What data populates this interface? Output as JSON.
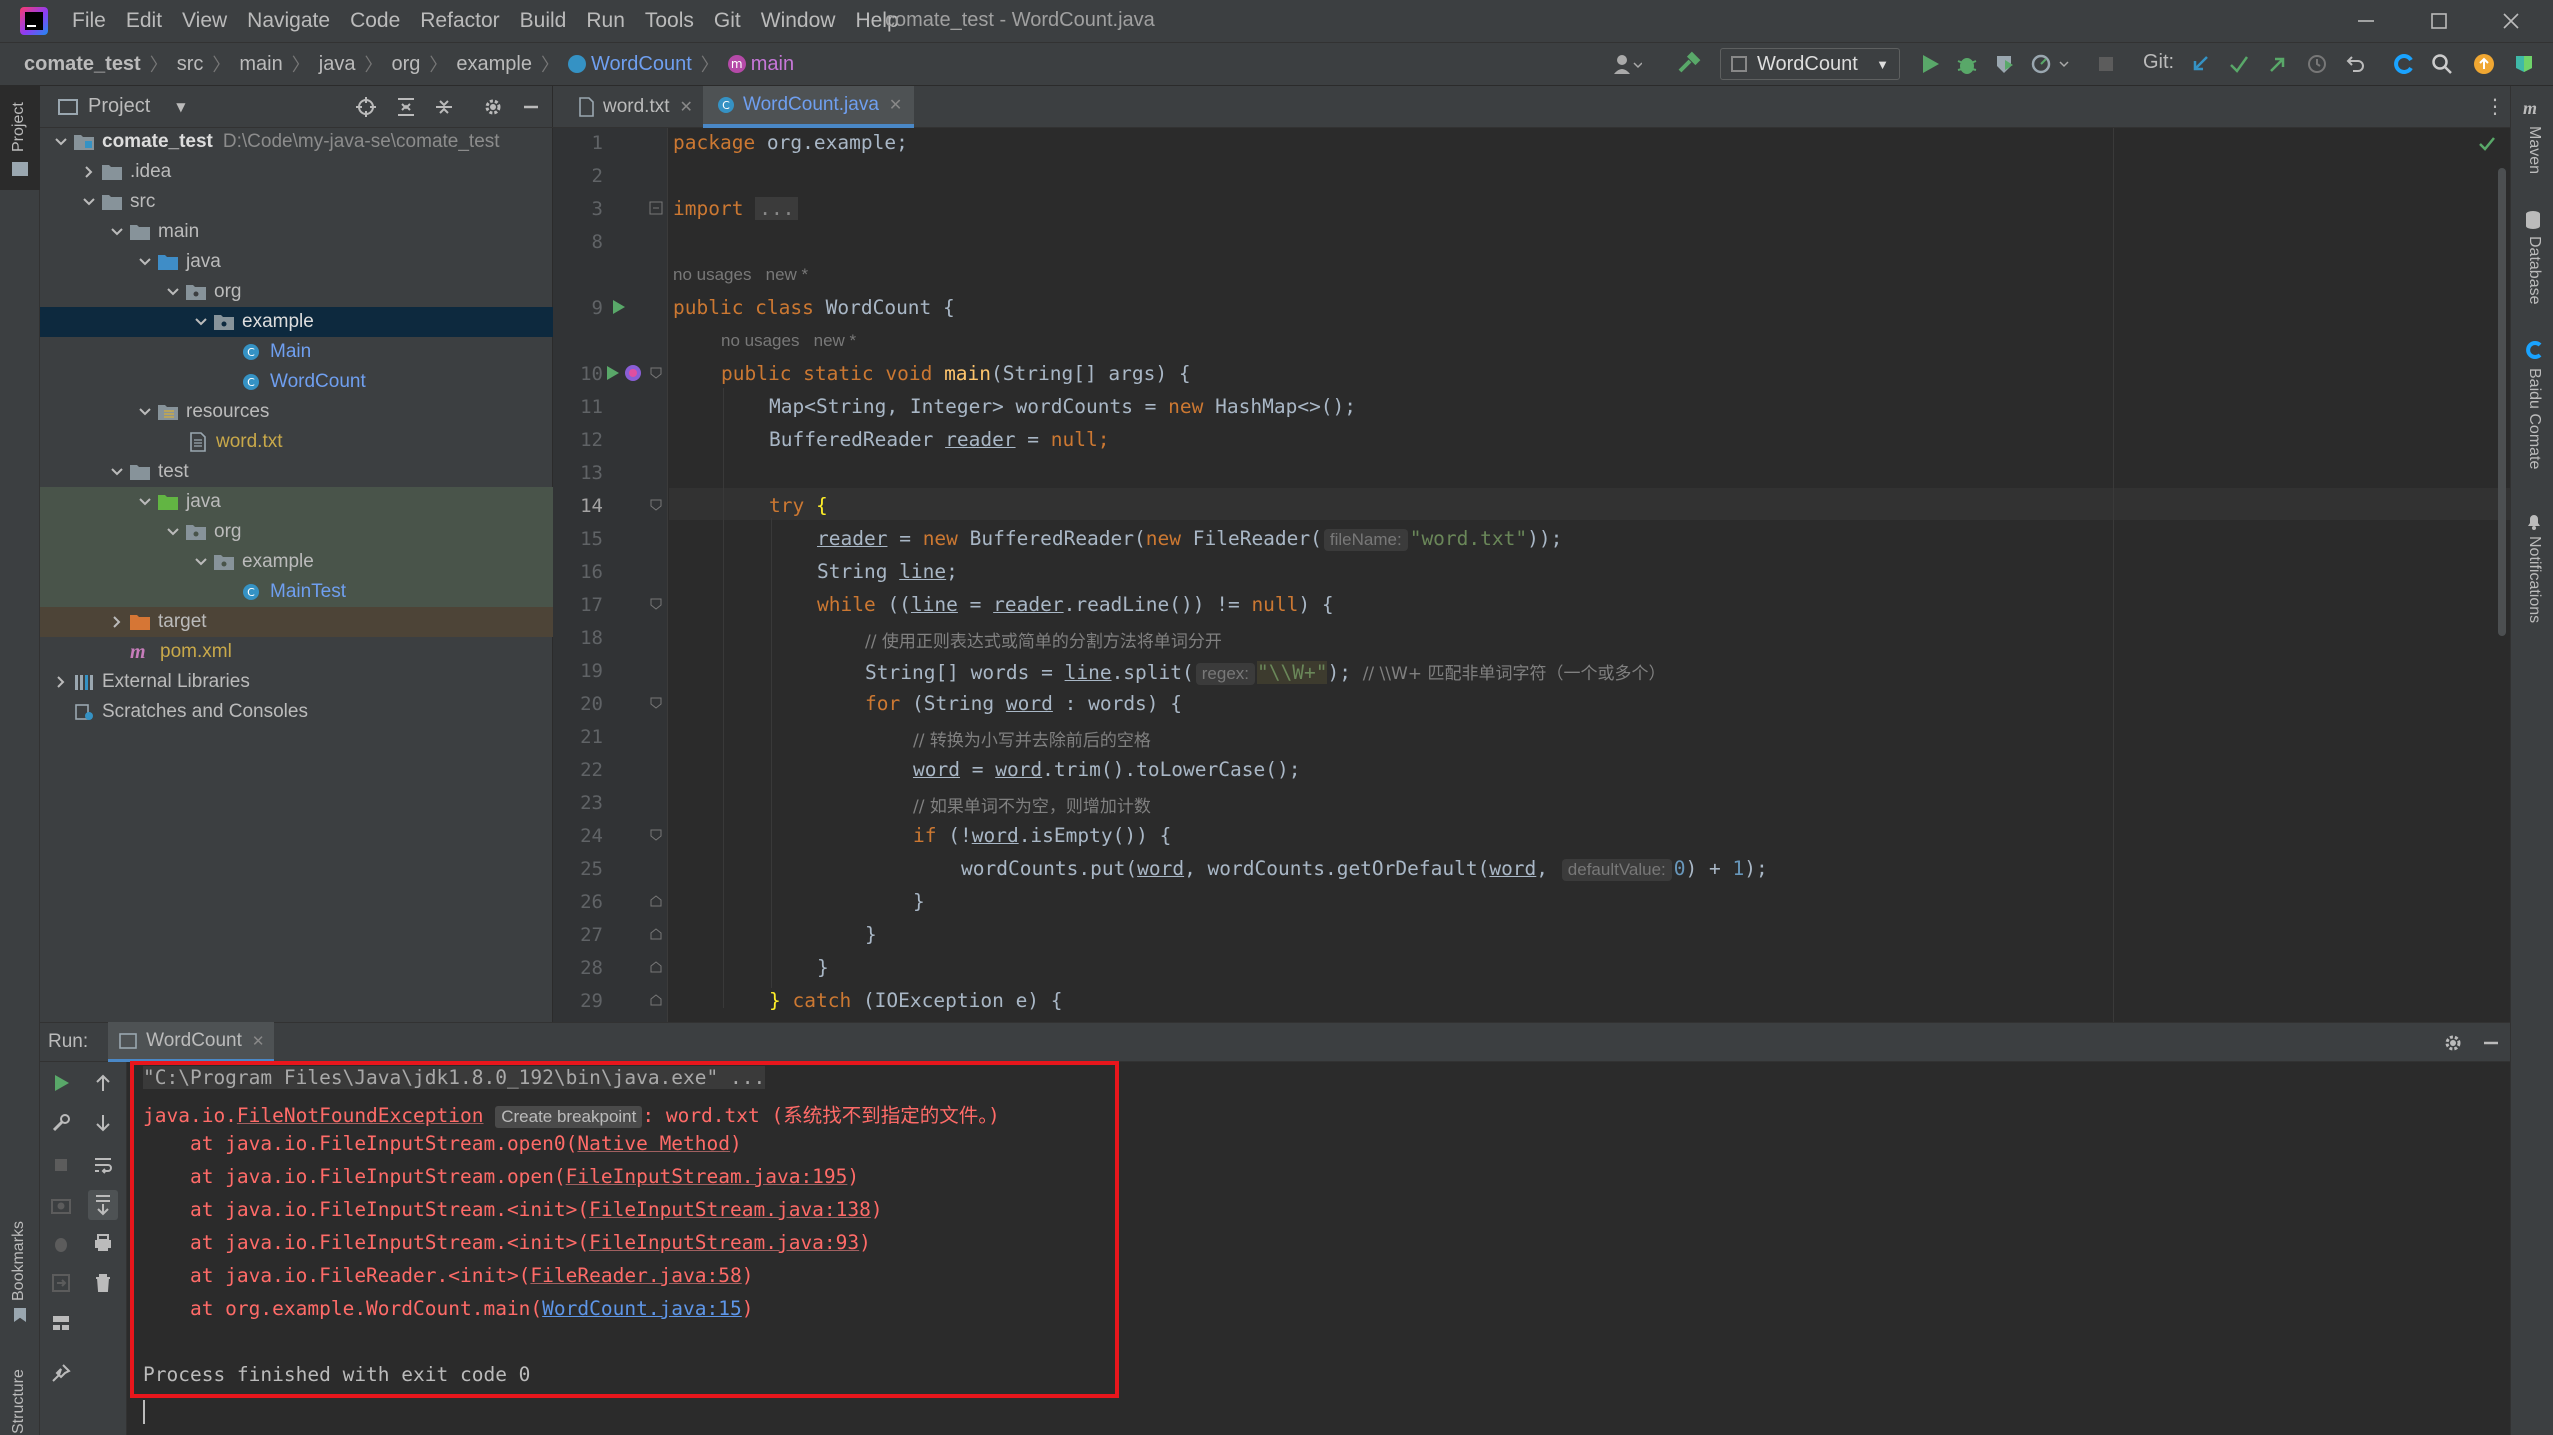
{
  "window": {
    "title": "comate_test - WordCount.java"
  },
  "menu": [
    "File",
    "Edit",
    "View",
    "Navigate",
    "Code",
    "Refactor",
    "Build",
    "Run",
    "Tools",
    "Git",
    "Window",
    "Help"
  ],
  "breadcrumbs": [
    "comate_test",
    "src",
    "main",
    "java",
    "org",
    "example",
    "WordCount",
    "main"
  ],
  "toolbar": {
    "run_config": "WordCount",
    "git_label": "Git:"
  },
  "left_strip": {
    "project": "Project",
    "bookmarks": "Bookmarks",
    "structure": "Structure"
  },
  "right_strip": {
    "maven": "Maven",
    "database": "Database",
    "baidu_comate": "Baidu Comate",
    "notifications": "Notifications"
  },
  "project_panel": {
    "title": "Project",
    "tree": [
      {
        "label": "comate_test",
        "path": "D:\\Code\\my-java-se\\comate_test"
      },
      {
        "label": ".idea"
      },
      {
        "label": "src"
      },
      {
        "label": "main"
      },
      {
        "label": "java"
      },
      {
        "label": "org"
      },
      {
        "label": "example"
      },
      {
        "label": "Main"
      },
      {
        "label": "WordCount"
      },
      {
        "label": "resources"
      },
      {
        "label": "word.txt"
      },
      {
        "label": "test"
      },
      {
        "label": "java"
      },
      {
        "label": "org"
      },
      {
        "label": "example"
      },
      {
        "label": "MainTest"
      },
      {
        "label": "target"
      },
      {
        "label": "pom.xml"
      },
      {
        "label": "External Libraries"
      },
      {
        "label": "Scratches and Consoles"
      }
    ]
  },
  "editor_tabs": [
    "word.txt",
    "WordCount.java"
  ],
  "editor": {
    "line_numbers": [
      "1",
      "2",
      "3",
      "8",
      "9",
      "10",
      "11",
      "12",
      "13",
      "14",
      "15",
      "16",
      "17",
      "18",
      "19",
      "20",
      "21",
      "22",
      "23",
      "24",
      "25",
      "26",
      "27",
      "28",
      "29"
    ],
    "usages_hint": "no usages",
    "new_hint": "new *",
    "code": {
      "l1": [
        "package",
        " org.example;"
      ],
      "l3": [
        "import",
        "..."
      ],
      "l9": [
        "public class",
        " WordCount {"
      ],
      "l10": [
        "public static void",
        " main",
        "(String[] args) {"
      ],
      "l11": [
        "Map<String, Integer> wordCounts = ",
        "new",
        " HashMap<>();"
      ],
      "l12": [
        "BufferedReader ",
        "reader",
        " = ",
        "null",
        ";"
      ],
      "l14": [
        "try",
        " {"
      ],
      "l15": [
        "reader",
        " = ",
        "new",
        " BufferedReader(",
        "new",
        " FileReader(",
        "fileName:",
        "\"word.txt\"",
        "));"
      ],
      "l16": [
        "String ",
        "line",
        ";"
      ],
      "l17": [
        "while",
        " ((",
        "line",
        " = ",
        "reader",
        ".readLine()) != ",
        "null",
        ") {"
      ],
      "l18": "// 使用正则表达式或简单的分割方法将单词分开",
      "l19": [
        "String[] words = ",
        "line",
        ".split(",
        "regex:",
        "\"\\\\W+\"",
        "); ",
        "// \\\\W+ 匹配非单词字符（一个或多个）"
      ],
      "l20": [
        "for",
        " (String ",
        "word",
        " : words) {"
      ],
      "l21": "// 转换为小写并去除前后的空格",
      "l22": [
        "word",
        " = ",
        "word",
        ".trim().toLowerCase();"
      ],
      "l23": "// 如果单词不为空，则增加计数",
      "l24": [
        "if",
        " (!",
        "word",
        ".isEmpty()) {"
      ],
      "l25": [
        "wordCounts.put(",
        "word",
        ", wordCounts.getOrDefault(",
        "word",
        ", ",
        "defaultValue:",
        "0",
        ") + ",
        "1",
        ");"
      ],
      "l26": "}",
      "l27": "}",
      "l28": "}",
      "l29": [
        "}",
        " catch",
        " (IOException e) {"
      ]
    }
  },
  "run_panel": {
    "label": "Run:",
    "tab": "WordCount",
    "console": {
      "cmd": "\"C:\\Program Files\\Java\\jdk1.8.0_192\\bin\\java.exe\" ...",
      "exception_pkg": "java.io.",
      "exception_cls": "FileNotFoundException",
      "create_breakpoint": "Create breakpoint",
      "exception_msg": ": word.txt (系统找不到指定的文件。)",
      "stack": [
        {
          "prefix": "    at java.io.FileInputStream.open0(",
          "link": "Native Method",
          "suffix": ")"
        },
        {
          "prefix": "    at java.io.FileInputStream.open(",
          "link": "FileInputStream.java:195",
          "suffix": ")"
        },
        {
          "prefix": "    at java.io.FileInputStream.<init>(",
          "link": "FileInputStream.java:138",
          "suffix": ")"
        },
        {
          "prefix": "    at java.io.FileInputStream.<init>(",
          "link": "FileInputStream.java:93",
          "suffix": ")"
        },
        {
          "prefix": "    at java.io.FileReader.<init>(",
          "link": "FileReader.java:58",
          "suffix": ")"
        },
        {
          "prefix": "    at org.example.WordCount.main(",
          "link": "WordCount.java:15",
          "suffix": ")"
        }
      ],
      "exit": "Process finished with exit code 0"
    }
  },
  "colors": {
    "highlight_box": "#e8161c",
    "error_text": "#ff6b68",
    "keyword": "#cc7832",
    "string": "#6a8759"
  }
}
